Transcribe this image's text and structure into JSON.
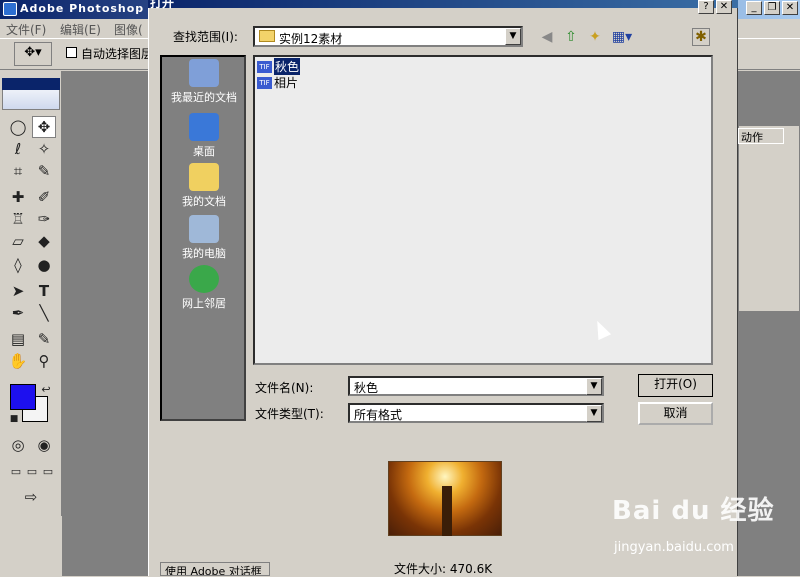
{
  "app": {
    "title": "Adobe Photoshop",
    "menu": [
      "文件(F)",
      "编辑(E)",
      "图像("
    ],
    "options": {
      "auto_select_label": "自动选择图层"
    }
  },
  "palette": {
    "tab_label": "动作"
  },
  "dialog": {
    "title": "打开",
    "look_in_label": "查找范围(I):",
    "look_in_value": "实例12素材",
    "places": [
      {
        "label": "我最近的文档",
        "icon": "recent-docs-icon"
      },
      {
        "label": "桌面",
        "icon": "desktop-icon"
      },
      {
        "label": "我的文档",
        "icon": "my-documents-icon"
      },
      {
        "label": "我的电脑",
        "icon": "my-computer-icon"
      },
      {
        "label": "网上邻居",
        "icon": "network-icon"
      }
    ],
    "files": [
      {
        "name": "秋色",
        "type": "TIF",
        "selected": true
      },
      {
        "name": "相片",
        "type": "TIF",
        "selected": false
      }
    ],
    "filename_label": "文件名(N):",
    "filename_value": "秋色",
    "filetype_label": "文件类型(T):",
    "filetype_value": "所有格式",
    "open_button": "打开(O)",
    "cancel_button": "取消",
    "file_size": "文件大小: 470.6K",
    "use_label": "使用 Adobe 对话框"
  },
  "watermark": {
    "logo": "Bai du 经验",
    "url": "jingyan.baidu.com"
  },
  "colors": {
    "foreground": "#1d10ef",
    "background": "#f4f4f4",
    "titlebar": "#0a246a"
  }
}
